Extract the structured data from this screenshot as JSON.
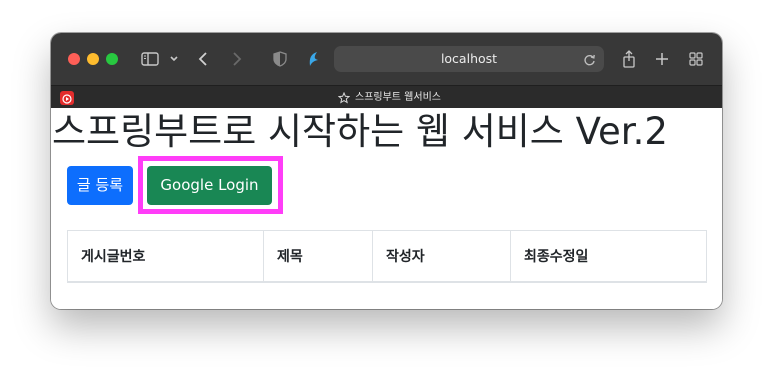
{
  "browser": {
    "url": "localhost",
    "tab_title": "스프링부트 웹서비스",
    "icons": [
      "close-dot",
      "minimize-dot",
      "zoom-dot",
      "sidebar-icon",
      "chevron-down-icon",
      "back-icon",
      "forward-icon",
      "shield-icon",
      "extension-icon",
      "reload-icon",
      "share-icon",
      "new-tab-icon",
      "tab-overview-icon",
      "youtube-favicon",
      "star-icon"
    ]
  },
  "page": {
    "title": "스프링부트로 시작하는 웹 서비스 Ver.2",
    "buttons": {
      "write_post": "글 등록",
      "google_login": "Google Login"
    },
    "table": {
      "headers": [
        "게시글번호",
        "제목",
        "작성자",
        "최종수정일"
      ]
    }
  },
  "colors": {
    "primary": "#0d6efd",
    "success": "#198754",
    "highlight": "#ff3df8",
    "toolbar": "#383838"
  }
}
